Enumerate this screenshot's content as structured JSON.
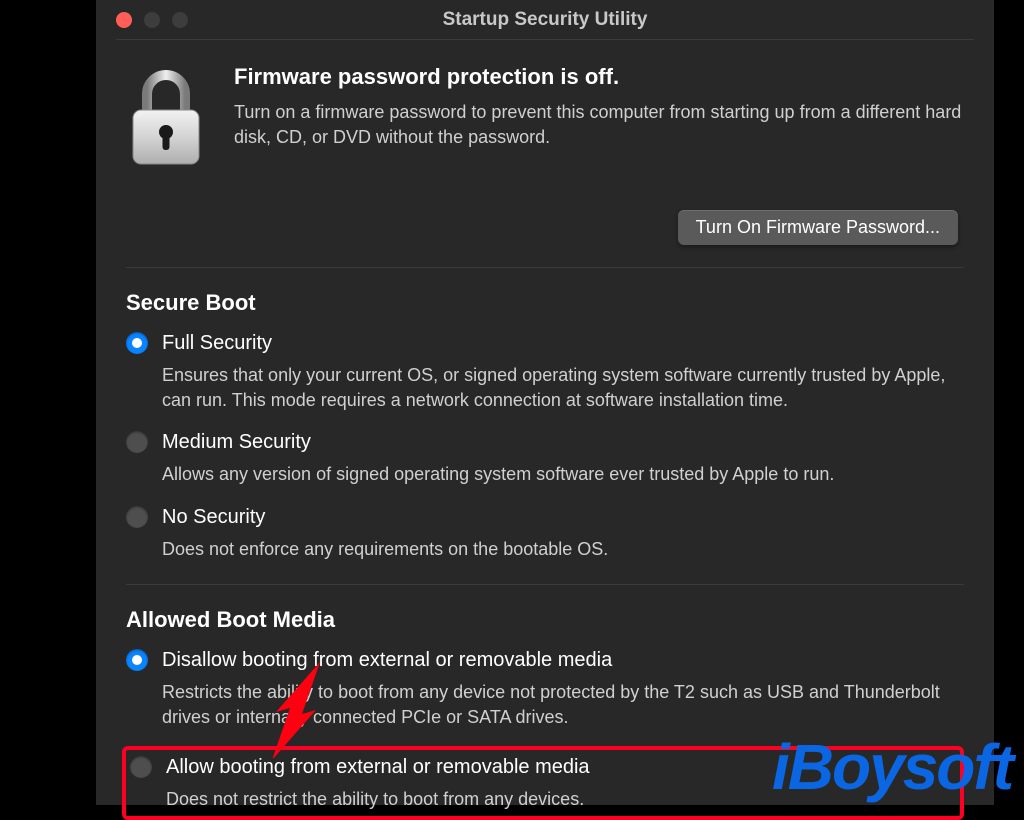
{
  "window": {
    "title": "Startup Security Utility"
  },
  "firmware": {
    "title": "Firmware password protection is off.",
    "description": "Turn on a firmware password to prevent this computer from starting up from a different hard disk, CD, or DVD without the password.",
    "button": "Turn On Firmware Password..."
  },
  "secure_boot": {
    "title": "Secure Boot",
    "options": [
      {
        "label": "Full Security",
        "description": "Ensures that only your current OS, or signed operating system software currently trusted by Apple, can run. This mode requires a network connection at software installation time.",
        "selected": true
      },
      {
        "label": "Medium Security",
        "description": "Allows any version of signed operating system software ever trusted by Apple to run.",
        "selected": false
      },
      {
        "label": "No Security",
        "description": "Does not enforce any requirements on the bootable OS.",
        "selected": false
      }
    ]
  },
  "allowed_boot_media": {
    "title": "Allowed Boot Media",
    "options": [
      {
        "label": "Disallow booting from external or removable media",
        "description": "Restricts the ability to boot from any device not protected by the T2 such as USB and Thunderbolt drives or internally connected PCIe or SATA drives.",
        "selected": true
      },
      {
        "label": "Allow booting from external or removable media",
        "description": "Does not restrict the ability to boot from any devices.",
        "selected": false
      }
    ]
  },
  "watermark": "iBoysoft"
}
